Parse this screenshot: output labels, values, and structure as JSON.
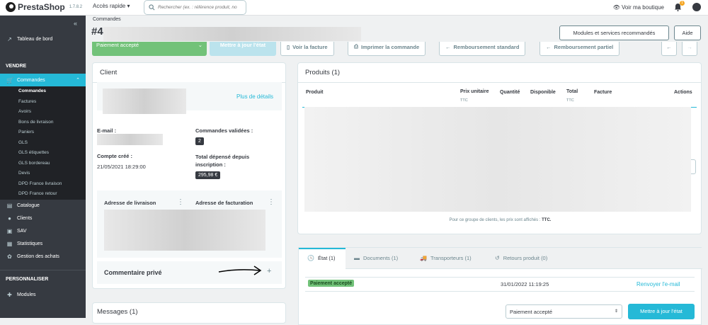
{
  "header": {
    "brand": "PrestaShop",
    "version": "1.7.8.2",
    "quick_access": "Accès rapide",
    "search_placeholder": "Rechercher (ex. : référence produit, no",
    "view_shop": "Voir ma boutique",
    "notif_count": "1"
  },
  "sidebar": {
    "dashboard": "Tableau de bord",
    "section_sell": "VENDRE",
    "orders": "Commandes",
    "orders_sub": [
      "Commandes",
      "Factures",
      "Avoirs",
      "Bons de livraison",
      "Paniers",
      "GLS",
      "GLS étiquettes",
      "GLS bordereau",
      "Devis",
      "DPD France livraison",
      "DPD France retour"
    ],
    "catalog": "Catalogue",
    "customers": "Clients",
    "sav": "SAV",
    "stats": "Statistiques",
    "purchases": "Gestion des achats",
    "section_custom": "PERSONNALISER",
    "modules": "Modules"
  },
  "page": {
    "breadcrumb": "Commandes",
    "order_prefix": "#4",
    "modules_btn": "Modules et services recommandés",
    "help_btn": "Aide"
  },
  "actions": {
    "status": "Paiement accepté",
    "update_status": "Mettre à jour l'état",
    "view_invoice": "Voir la facture",
    "print": "Imprimer la commande",
    "standard_refund": "Remboursement standard",
    "partial_refund": "Remboursement partiel"
  },
  "client": {
    "title": "Client",
    "more_details": "Plus de détails",
    "email_label": "E-mail :",
    "validated_label": "Commandes validées :",
    "validated_count": "2",
    "created_label": "Compte créé :",
    "created_value": "21/05/2021 18:29:00",
    "spent_label": "Total dépensé depuis inscription :",
    "spent_value": "295,98 €",
    "shipping_address": "Adresse de livraison",
    "billing_address": "Adresse de facturation",
    "private_comment": "Commentaire privé",
    "add": "+"
  },
  "messages": {
    "title": "Messages (1)"
  },
  "products": {
    "title": "Produits (1)",
    "columns": {
      "product": "Produit",
      "unit_price": "Prix unitaire",
      "qty": "Quantité",
      "available": "Disponible",
      "total": "Total",
      "invoice": "Facture",
      "actions": "Actions"
    },
    "ttc": "TTC",
    "note_prefix": "Pour ce groupe de clients, les prix sont affichés : ",
    "note_bold": "TTC."
  },
  "tabs": [
    "État (1)",
    "Documents (1)",
    "Transporteurs (1)",
    "Retours produit (0)"
  ],
  "history": {
    "status": "Paiement accepté",
    "date": "31/01/2022 11:19:25",
    "resend": "Renvoyer l'e-mail",
    "select_value": "Paiement accepté",
    "update": "Mettre à jour l'état"
  },
  "colors": {
    "accent": "#25b9d7",
    "success": "#72c279",
    "dark": "#363a41"
  }
}
